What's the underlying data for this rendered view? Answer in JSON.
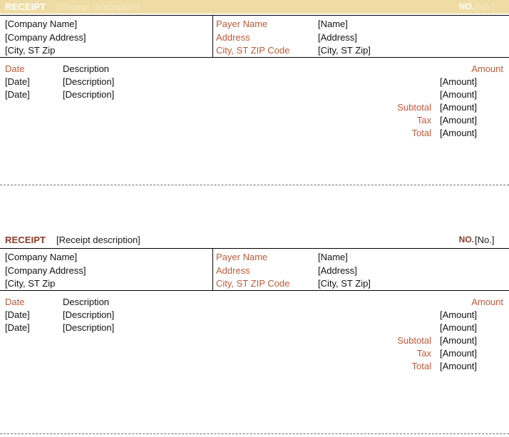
{
  "document": {
    "title": "Receipt",
    "copies": 2
  },
  "colors": {
    "band_background": "#EFDCA4",
    "band_text": "#FFFFFF",
    "band_secondary_text": "#F4E7C0",
    "accent_rust": "#BC5B38",
    "accent_dark_brown": "#8C3A28",
    "body_text": "#111111",
    "rule": "#000000",
    "cut_line": "#6E6E6E"
  },
  "receipts": [
    {
      "variant": "filled",
      "header": {
        "title": "RECEIPT",
        "description": "[Receipt description]",
        "number_label": "NO.",
        "number_value": "[No.]"
      },
      "company": {
        "name": "[Company Name]",
        "address": "[Company Address]",
        "city_state_zip": "[City, ST  Zip"
      },
      "payer_labels": {
        "name": "Payer Name",
        "address": "Address",
        "city_state_zip": "City, ST ZIP Code"
      },
      "payer_values": {
        "name": "[Name]",
        "address": "[Address]",
        "city_state_zip": "[City, ST  Zip]"
      },
      "table": {
        "headers": {
          "date": "Date",
          "description": "Description",
          "amount": "Amount"
        },
        "rows": [
          {
            "date": "[Date]",
            "description": "[Description]",
            "amount": "[Amount]"
          },
          {
            "date": "[Date]",
            "description": "[Description]",
            "amount": "[Amount]"
          }
        ],
        "totals": [
          {
            "label": "Subtotal",
            "amount": "[Amount]"
          },
          {
            "label": "Tax",
            "amount": "[Amount]"
          },
          {
            "label": "Total",
            "amount": "[Amount]"
          }
        ]
      }
    },
    {
      "variant": "plain",
      "header": {
        "title": "RECEIPT",
        "description": "[Receipt description]",
        "number_label": "NO.",
        "number_value": "[No.]"
      },
      "company": {
        "name": "[Company Name]",
        "address": "[Company Address]",
        "city_state_zip": "[City, ST  Zip"
      },
      "payer_labels": {
        "name": "Payer Name",
        "address": "Address",
        "city_state_zip": "City, ST ZIP Code"
      },
      "payer_values": {
        "name": "[Name]",
        "address": "[Address]",
        "city_state_zip": "[City, ST  Zip]"
      },
      "table": {
        "headers": {
          "date": "Date",
          "description": "Description",
          "amount": "Amount"
        },
        "rows": [
          {
            "date": "[Date]",
            "description": "[Description]",
            "amount": "[Amount]"
          },
          {
            "date": "[Date]",
            "description": "[Description]",
            "amount": "[Amount]"
          }
        ],
        "totals": [
          {
            "label": "Subtotal",
            "amount": "[Amount]"
          },
          {
            "label": "Tax",
            "amount": "[Amount]"
          },
          {
            "label": "Total",
            "amount": "[Amount]"
          }
        ]
      }
    }
  ]
}
